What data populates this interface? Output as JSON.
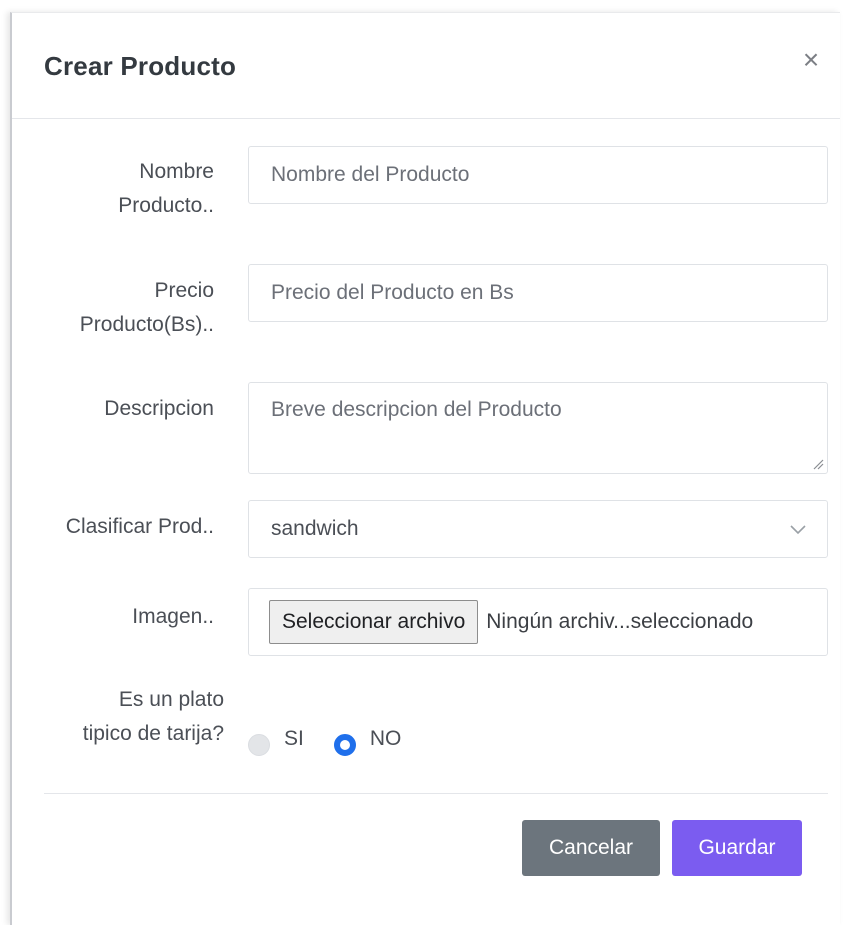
{
  "modal": {
    "title": "Crear Producto",
    "close_label": "×"
  },
  "form": {
    "nombre": {
      "label_line1": "Nombre",
      "label_line2": "Producto..",
      "placeholder": "Nombre del Producto"
    },
    "precio": {
      "label_line1": "Precio",
      "label_line2": "Producto(Bs)..",
      "placeholder": "Precio del Producto en Bs"
    },
    "descripcion": {
      "label": "Descripcion",
      "placeholder": "Breve descripcion del Producto"
    },
    "clasificar": {
      "label": "Clasificar Prod..",
      "selected": "sandwich"
    },
    "imagen": {
      "label": "Imagen..",
      "button_label": "Seleccionar archivo",
      "status": "Ningún archiv...seleccionado"
    },
    "plato_tipico": {
      "label_line1": "Es un plato",
      "label_line2": "tipico de tarija?",
      "options": [
        {
          "label": "SI",
          "selected": false
        },
        {
          "label": "NO",
          "selected": true
        }
      ]
    }
  },
  "footer": {
    "cancel_label": "Cancelar",
    "save_label": "Guardar"
  },
  "colors": {
    "cancel_bg": "#6c757d",
    "save_bg": "#7b5cf0",
    "radio_selected": "#1f6feb"
  },
  "icons": {
    "close": "close-icon",
    "dropdown": "chevron-down-icon",
    "resize": "resize-grip-icon"
  }
}
